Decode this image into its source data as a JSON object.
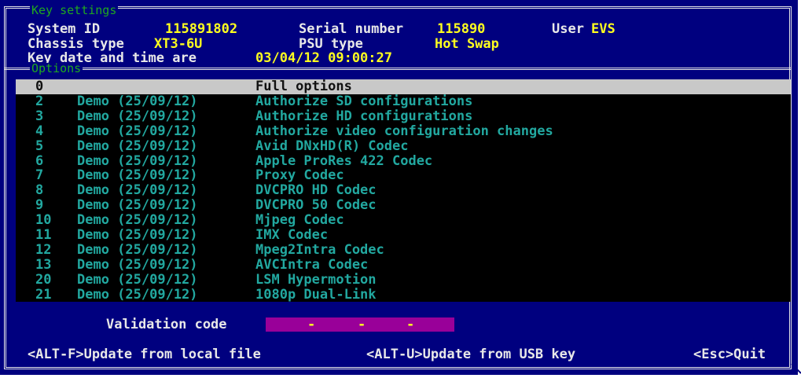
{
  "key_settings": {
    "section_title": "Key settings",
    "system_id_label": "System ID",
    "system_id_value": "115891802",
    "serial_label": "Serial number",
    "serial_value": "115890",
    "user_label": "User",
    "user_value": "EVS",
    "chassis_label": "Chassis type",
    "chassis_value": "XT3-6U",
    "psu_label": "PSU type",
    "psu_value": "Hot Swap",
    "date_label": "Key date and time are",
    "date_value": "03/04/12 09:00:27"
  },
  "options": {
    "section_title": "Options",
    "rows": [
      {
        "num": "0",
        "demo": "",
        "desc": "Full options",
        "selected": true
      },
      {
        "num": "2",
        "demo": "Demo (25/09/12)",
        "desc": "Authorize SD configurations"
      },
      {
        "num": "3",
        "demo": "Demo (25/09/12)",
        "desc": "Authorize HD configurations"
      },
      {
        "num": "4",
        "demo": "Demo (25/09/12)",
        "desc": "Authorize video configuration changes"
      },
      {
        "num": "5",
        "demo": "Demo (25/09/12)",
        "desc": "Avid DNxHD(R) Codec"
      },
      {
        "num": "6",
        "demo": "Demo (25/09/12)",
        "desc": "Apple ProRes 422 Codec"
      },
      {
        "num": "7",
        "demo": "Demo (25/09/12)",
        "desc": "Proxy Codec"
      },
      {
        "num": "8",
        "demo": "Demo (25/09/12)",
        "desc": "DVCPRO HD Codec"
      },
      {
        "num": "9",
        "demo": "Demo (25/09/12)",
        "desc": "DVCPRO 50 Codec"
      },
      {
        "num": "10",
        "demo": "Demo (25/09/12)",
        "desc": "Mjpeg Codec"
      },
      {
        "num": "11",
        "demo": "Demo (25/09/12)",
        "desc": "IMX Codec"
      },
      {
        "num": "12",
        "demo": "Demo (25/09/12)",
        "desc": "Mpeg2Intra Codec"
      },
      {
        "num": "13",
        "demo": "Demo (25/09/12)",
        "desc": "AVCIntra Codec"
      },
      {
        "num": "20",
        "demo": "Demo (25/09/12)",
        "desc": "LSM Hypermotion"
      },
      {
        "num": "21",
        "demo": "Demo (25/09/12)",
        "desc": "1080p Dual-Link"
      }
    ]
  },
  "validation": {
    "label": "Validation code",
    "separators": [
      "-",
      "-",
      "-"
    ]
  },
  "footer": {
    "update_file": "<ALT-F>Update from local file",
    "update_usb": "<ALT-U>Update from USB key",
    "quit": "<Esc>Quit"
  },
  "colors": {
    "background": "#00007f",
    "list_background": "#000000",
    "option_text": "#22a8a0",
    "highlight_value": "#ffff1f",
    "validation_field": "#990099",
    "section_title": "#1fa81f"
  }
}
